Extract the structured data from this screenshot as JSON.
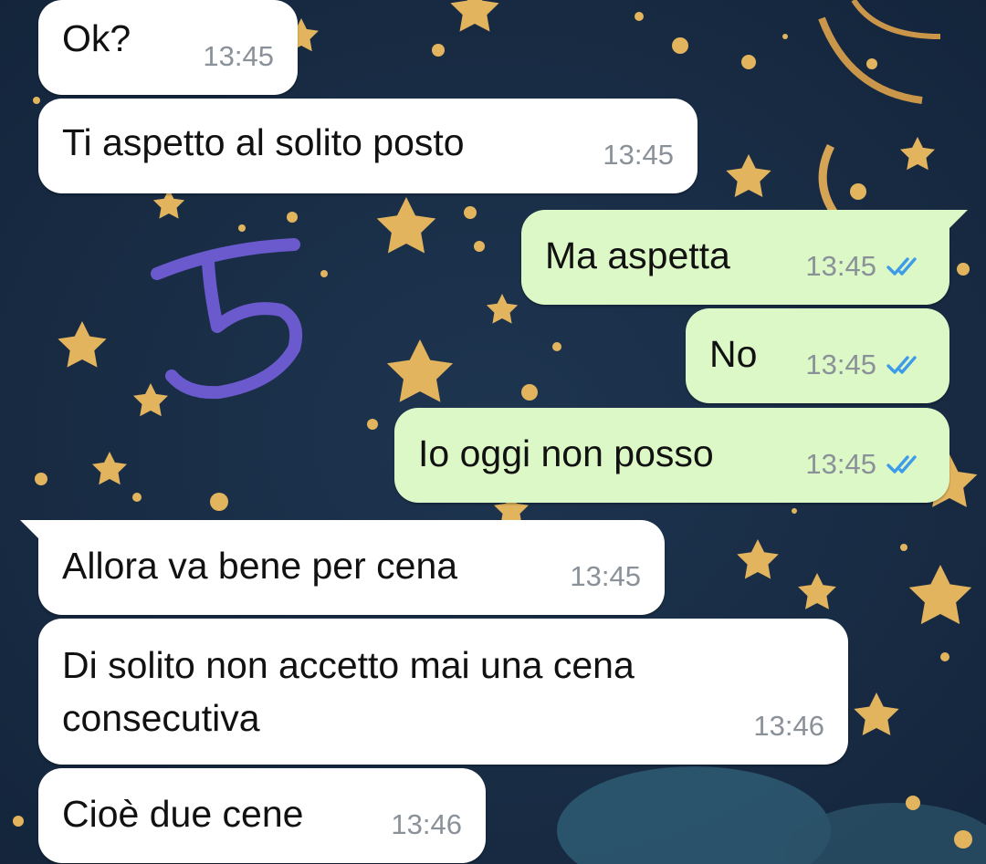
{
  "theme": {
    "wallpaper_color": "#1a2d40",
    "incoming_bubble": "#ffffff",
    "outgoing_bubble": "#dcf8c6",
    "timestamp_color": "#8a9198",
    "read_tick_color": "#3d9be9",
    "star_color": "#e3b45e",
    "scribble_color": "#6a5acd"
  },
  "messages": [
    {
      "direction": "incoming",
      "text": "Ok?",
      "time": "13:45"
    },
    {
      "direction": "incoming",
      "text": "Ti aspetto al solito posto",
      "time": "13:45"
    },
    {
      "direction": "outgoing",
      "text": "Ma aspetta",
      "time": "13:45",
      "status": "read"
    },
    {
      "direction": "outgoing",
      "text": "No",
      "time": "13:45",
      "status": "read"
    },
    {
      "direction": "outgoing",
      "text": "Io oggi non posso",
      "time": "13:45",
      "status": "read"
    },
    {
      "direction": "incoming",
      "text": "Allora va bene per cena",
      "time": "13:45"
    },
    {
      "direction": "incoming",
      "text": "Di solito non accetto mai una cena consecutiva",
      "time": "13:46"
    },
    {
      "direction": "incoming",
      "text": "Cioè due cene",
      "time": "13:46"
    }
  ],
  "icons": {
    "read_ticks": "double-check-icon"
  }
}
